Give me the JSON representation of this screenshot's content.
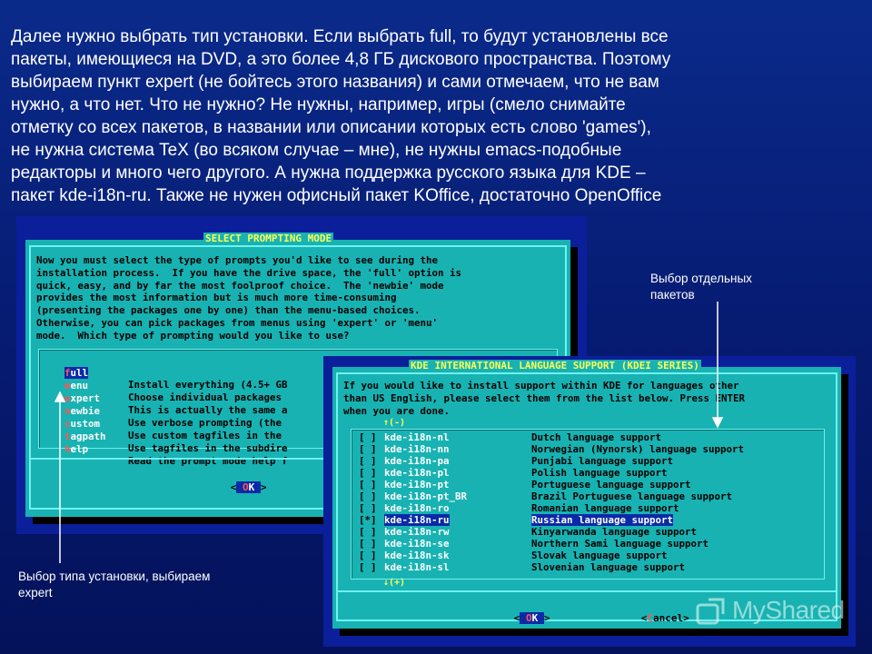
{
  "intro": {
    "lines": [
      "Далее нужно выбрать тип установки. Если выбрать full, то будут установлены все",
      "пакеты, имеющиеся на DVD, а это более 4,8 ГБ дискового пространства. Поэтому",
      "выбираем пункт expert (не бойтесь этого названия) и сами отмечаем, что не вам",
      "нужно, а что нет. Что не нужно? Не нужны, например, игры (смело снимайте",
      "отметку со всех пакетов, в названии или описании которых есть слово 'games'),",
      "не нужна система TeX (во всяком случае – мне), не нужны emacs-подобные",
      "редакторы и много чего другого. А нужна поддержка русского языка для KDE –",
      "пакет kde-i18n-ru. Также не нужен офисный пакет KOffice, достаточно OpenOffice"
    ]
  },
  "prompt_dialog": {
    "title": "SELECT PROMPTING MODE",
    "text": [
      "Now you must select the type of prompts you'd like to see during the",
      "installation process.  If you have the drive space, the 'full' option is",
      "quick, easy, and by far the most foolproof choice.  The 'newbie' mode",
      "provides the most information but is much more time-consuming",
      "(presenting the packages one by one) than the menu-based choices.",
      "Otherwise, you can pick packages from menus using 'expert' or 'menu'",
      "mode.  Which type of prompting would you like to use?"
    ],
    "options": [
      {
        "hot": "f",
        "rest": "ull",
        "desc": "Install everything (4.5+ GB"
      },
      {
        "hot": "m",
        "rest": "enu",
        "desc": "Choose individual packages"
      },
      {
        "hot": "e",
        "rest": "xpert",
        "desc": "This is actually the same a"
      },
      {
        "hot": "n",
        "rest": "ewbie",
        "desc": "Use verbose prompting (the "
      },
      {
        "hot": "c",
        "rest": "ustom",
        "desc": "Use custom tagfiles in the "
      },
      {
        "hot": "t",
        "rest": "agpath",
        "desc": "Use tagfiles in the subdire"
      },
      {
        "hot": "h",
        "rest": "elp",
        "desc": "Read the prompt mode help f"
      }
    ],
    "ok_button": {
      "left": "<",
      "hot": " O",
      "rest": "K ",
      "right": ">"
    }
  },
  "kde_dialog": {
    "title": "KDE INTERNATIONAL LANGUAGE SUPPORT (KDEI SERIES)",
    "text": [
      "If you would like to install support within KDE for languages other",
      "than US English, please select them from the list below. Press ENTER",
      "when you are done."
    ],
    "scroll_up": "↑(-)",
    "scroll_down": "↓(+)",
    "packages": [
      {
        "check": "[ ]",
        "name": "kde-i18n-nl",
        "desc": "Dutch language support"
      },
      {
        "check": "[ ]",
        "name": "kde-i18n-nn",
        "desc": "Norwegian (Nynorsk) language support"
      },
      {
        "check": "[ ]",
        "name": "kde-i18n-pa",
        "desc": "Punjabi language support"
      },
      {
        "check": "[ ]",
        "name": "kde-i18n-pl",
        "desc": "Polish language support"
      },
      {
        "check": "[ ]",
        "name": "kde-i18n-pt",
        "desc": "Portuguese language support"
      },
      {
        "check": "[ ]",
        "name": "kde-i18n-pt_BR",
        "desc": "Brazil Portuguese language support"
      },
      {
        "check": "[ ]",
        "name": "kde-i18n-ro",
        "desc": "Romanian language support"
      },
      {
        "check": "[*]",
        "name": "kde-i18n-ru",
        "desc": "Russian language support"
      },
      {
        "check": "[ ]",
        "name": "kde-i18n-rw",
        "desc": "Kinyarwanda language support"
      },
      {
        "check": "[ ]",
        "name": "kde-i18n-se",
        "desc": "Northern Sami language support"
      },
      {
        "check": "[ ]",
        "name": "kde-i18n-sk",
        "desc": "Slovak language support"
      },
      {
        "check": "[ ]",
        "name": "kde-i18n-sl",
        "desc": "Slovenian language support"
      }
    ],
    "ok_button": {
      "left": "<",
      "hot": " O",
      "rest": "K ",
      "right": ">"
    },
    "cancel_button": {
      "left": "<",
      "hot": "C",
      "rest": "ancel",
      "right": ">"
    }
  },
  "annotations": {
    "packages_note": [
      "Выбор отдельных",
      "пакетов"
    ],
    "mode_note": [
      "Выбор типа установки, выбираем",
      "expert"
    ]
  },
  "watermark": "MyShared",
  "colors": {
    "slide_bg": "#061a6e",
    "terminal_bg": "#0b1f9a",
    "dialog_bg": "#18b2b2",
    "dialog_title": "#ffff55",
    "hotkey": "#ff5555",
    "selection": "#0a2aa8"
  }
}
